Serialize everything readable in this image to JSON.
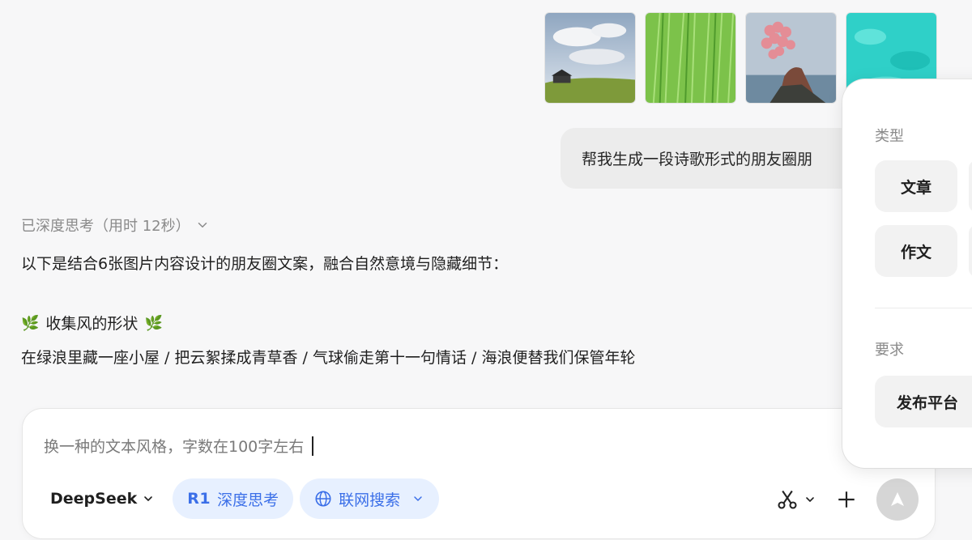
{
  "attachments": [
    {
      "name": "image-house-on-hill"
    },
    {
      "name": "image-green-grass"
    },
    {
      "name": "image-woman-balloons"
    },
    {
      "name": "image-turquoise-water"
    }
  ],
  "user_message": "帮我生成一段诗歌形式的朋友圈朋",
  "reply": {
    "thinking_label": "已深度思考（用时 12秒）",
    "intro": "以下是结合6张图片内容设计的朋友圈文案，融合自然意境与隐藏细节：",
    "poem_title": "收集风的形状",
    "poem_leaf": "🌿",
    "poem_line": "在绿浪里藏一座小屋 / 把云絮揉成青草香 / 气球偷走第十一句情话 / 海浪便替我们保管年轮"
  },
  "composer": {
    "input_value": "换一种的文本风格，字数在100字左右",
    "model_label": "DeepSeek",
    "deep_think_prefix": "R1",
    "deep_think_label": "深度思考",
    "web_search_label": "联网搜索"
  },
  "side_panel": {
    "type_label": "类型",
    "type_chips": [
      "文章",
      "作文"
    ],
    "requirement_label": "要求",
    "requirement_chips": [
      "发布平台"
    ]
  },
  "colors": {
    "accent": "#3b6fe8",
    "pill_bg": "#e7f0ff",
    "send_disabled": "#d6d6d6",
    "leaf": "#5aa845"
  }
}
